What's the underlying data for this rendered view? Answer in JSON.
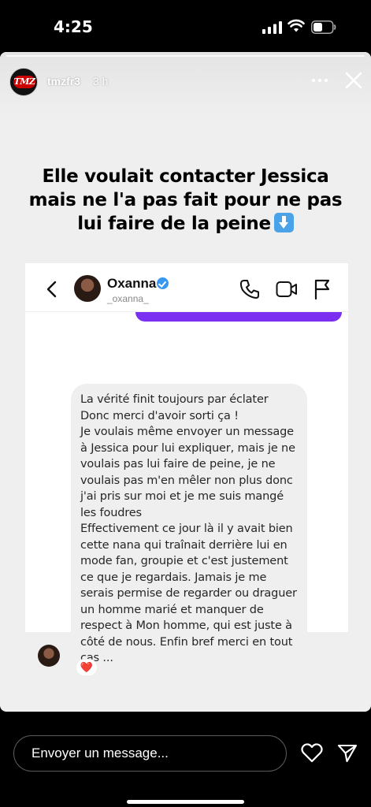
{
  "status_bar": {
    "time": "4:25"
  },
  "story": {
    "username": "tmzfr3",
    "time_ago": "3 h",
    "avatar_logo": "TMZ",
    "caption": "Elle voulait contacter Jessica mais ne l'a pas fait pour ne pas lui faire de la peine"
  },
  "dm": {
    "name": "Oxanna",
    "handle": "_oxanna_",
    "message_lines": [
      "La vérité finit toujours par éclater",
      "Donc merci d'avoir sorti ça !",
      "Je voulais même envoyer un message à Jessica pour lui expliquer, mais je ne voulais pas lui faire de peine, je ne voulais pas m'en mêler non plus donc j'ai pris sur moi et je me suis mangé les foudres",
      "Effectivement ce jour là il y avait bien cette nana qui traînait derrière lui en mode fan, groupie et c'est justement ce que je regardais. Jamais je me serais permise de regarder ou draguer un homme marié et manquer de respect à Mon homme, qui est juste à côté de nous. Enfin bref merci en tout cas ..."
    ],
    "reaction": "❤️"
  },
  "bottom_bar": {
    "message_placeholder": "Envoyer un message..."
  },
  "colors": {
    "accent_purple": "#7b2ff0",
    "verified_blue": "#3897f0",
    "heart_red": "#ed1c3c"
  }
}
